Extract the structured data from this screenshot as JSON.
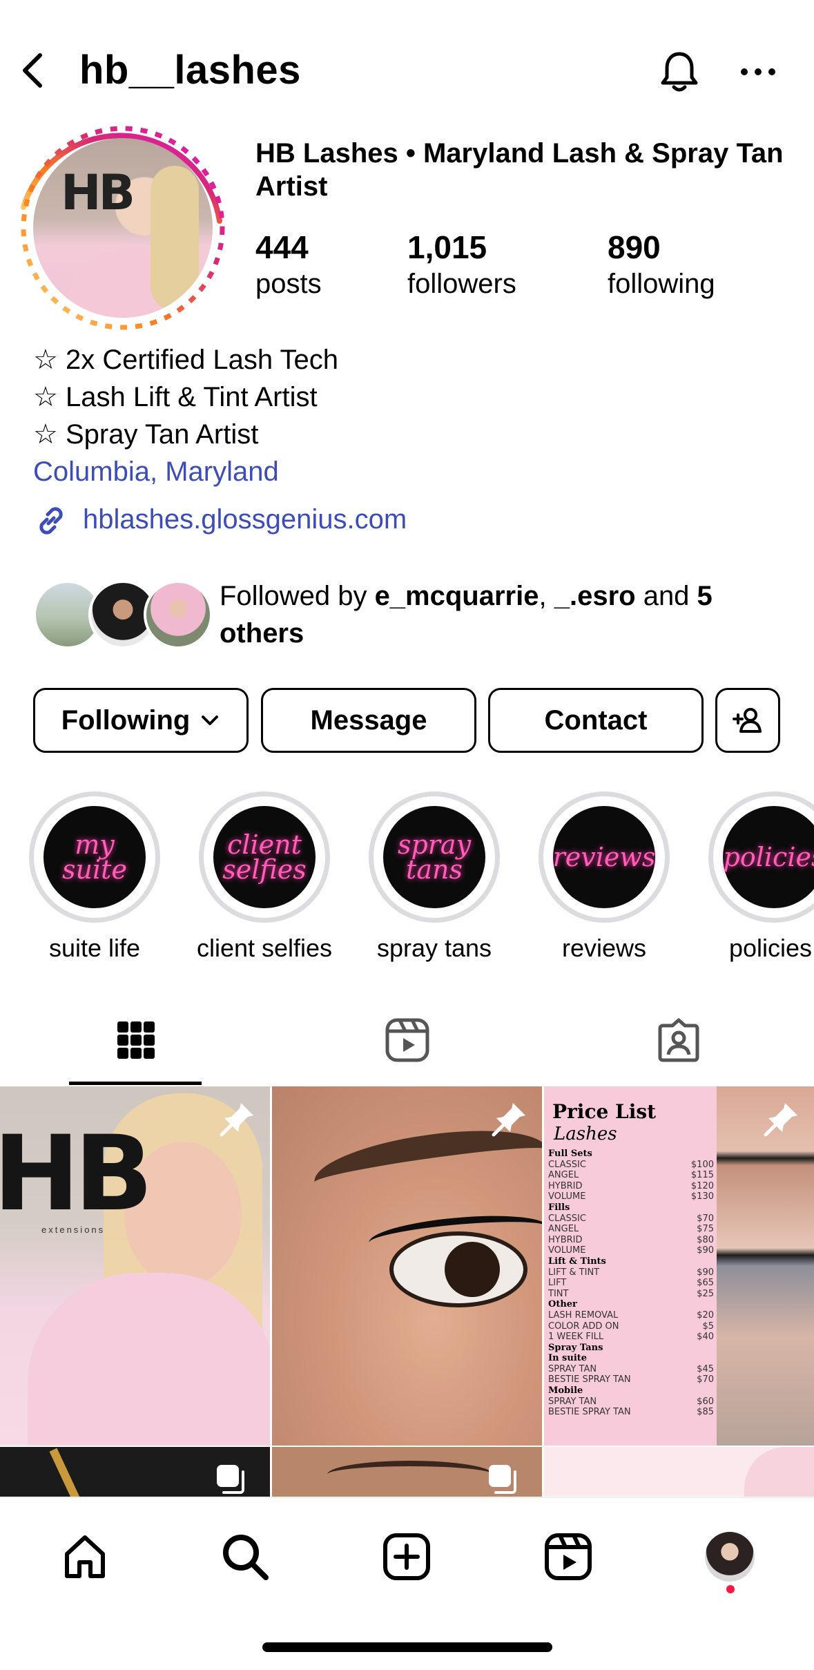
{
  "header": {
    "username": "hb__lashes"
  },
  "profile": {
    "display_name": "HB Lashes • Maryland Lash & Spray Tan Artist",
    "avatar_logo_text": "HB",
    "stats": [
      {
        "value": "444",
        "label": "posts"
      },
      {
        "value": "1,015",
        "label": "followers"
      },
      {
        "value": "890",
        "label": "following"
      }
    ],
    "bio_lines": [
      "☆ 2x Certified Lash Tech",
      "☆ Lash Lift & Tint Artist",
      "☆ Spray Tan Artist"
    ],
    "location": "Columbia, Maryland",
    "link": "hblashes.glossgenius.com"
  },
  "followed_by": {
    "prefix": "Followed by ",
    "user1": "e_mcquarrie",
    "sep": ", ",
    "user2": "_.esro",
    "mid": " and ",
    "count": "5",
    "suffix": "others"
  },
  "actions": {
    "following": "Following",
    "message": "Message",
    "contact": "Contact"
  },
  "highlights": [
    {
      "cover": "my suite",
      "label": "suite life"
    },
    {
      "cover": "client selfies",
      "label": "client selfies"
    },
    {
      "cover": "spray tans",
      "label": "spray tans"
    },
    {
      "cover": "reviews",
      "label": "reviews"
    },
    {
      "cover": "policies",
      "label": "policies"
    }
  ],
  "posts": {
    "post1_logo": "HB",
    "post1_sub": "extensions",
    "price_title": "Price List",
    "price_subtitle": "Lashes",
    "price_rows": [
      {
        "item": "Full Sets",
        "price": "",
        "section": true
      },
      {
        "item": "CLASSIC",
        "price": "$100"
      },
      {
        "item": "ANGEL",
        "price": "$115"
      },
      {
        "item": "HYBRID",
        "price": "$120"
      },
      {
        "item": "VOLUME",
        "price": "$130"
      },
      {
        "item": "Fills",
        "price": "",
        "section": true
      },
      {
        "item": "CLASSIC",
        "price": "$70"
      },
      {
        "item": "ANGEL",
        "price": "$75"
      },
      {
        "item": "HYBRID",
        "price": "$80"
      },
      {
        "item": "VOLUME",
        "price": "$90"
      },
      {
        "item": "Lift & Tints",
        "price": "",
        "section": true
      },
      {
        "item": "LIFT & TINT",
        "price": "$90"
      },
      {
        "item": "LIFT",
        "price": "$65"
      },
      {
        "item": "TINT",
        "price": "$25"
      },
      {
        "item": "Other",
        "price": "",
        "section": true
      },
      {
        "item": "LASH REMOVAL",
        "price": "$20"
      },
      {
        "item": "COLOR ADD ON",
        "price": "$5"
      },
      {
        "item": "1 WEEK FILL",
        "price": "$40"
      },
      {
        "item": "Spray Tans",
        "price": "",
        "section": true
      },
      {
        "item": "In suite",
        "price": "",
        "section": true
      },
      {
        "item": "SPRAY TAN",
        "price": "$45"
      },
      {
        "item": "BESTIE SPRAY TAN",
        "price": "$70"
      },
      {
        "item": "Mobile",
        "price": "",
        "section": true
      },
      {
        "item": "SPRAY TAN",
        "price": "$60"
      },
      {
        "item": "BESTIE SPRAY TAN",
        "price": "$85"
      }
    ]
  },
  "colors": {
    "link": "#3d4db7",
    "neon_pink": "#ff5fb8",
    "notification_dot": "#ff1744"
  }
}
